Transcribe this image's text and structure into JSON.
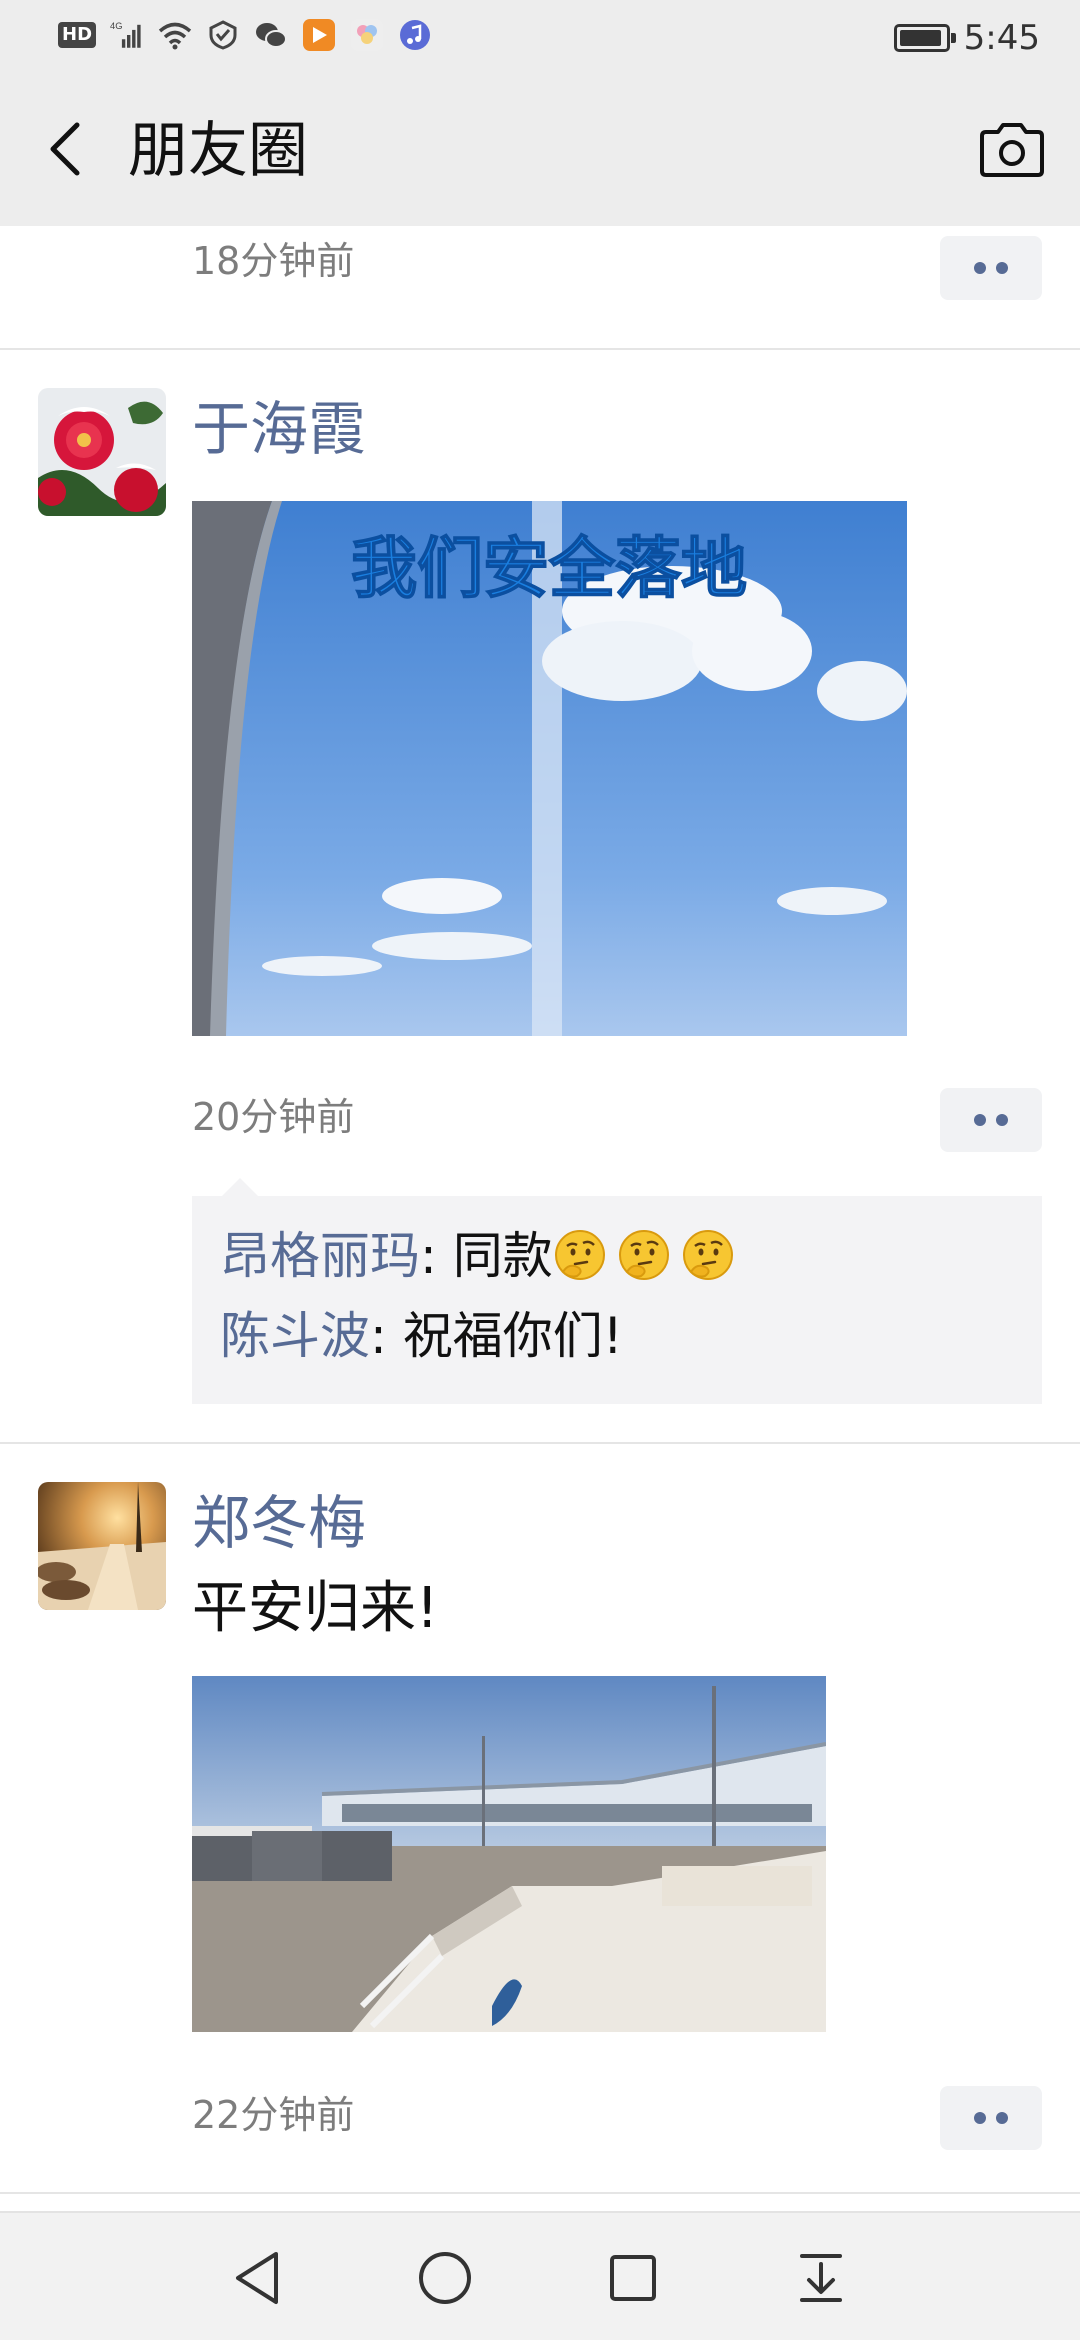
{
  "status_bar": {
    "hd_label": "HD",
    "network_label": "4G",
    "battery_level": 0.95,
    "time": "5:45",
    "icons": [
      "hd-icon",
      "signal-icon",
      "wifi-icon",
      "vpn-shield-icon",
      "wechat-icon",
      "video-app-icon",
      "photos-app-icon",
      "music-app-icon",
      "battery-icon"
    ]
  },
  "header": {
    "title": "朋友圈",
    "back_icon": "chevron-left-icon",
    "camera_icon": "camera-icon"
  },
  "feed": {
    "prev_post": {
      "time": "18分钟前"
    },
    "posts": [
      {
        "author": "于海霞",
        "avatar": "red-camellia-snow-photo",
        "image_caption": "我们安全落地",
        "time": "20分钟前",
        "comments": [
          {
            "name": "昂格丽玛",
            "separator": ": ",
            "text": "同款",
            "emoji": "thinking-face-emoji",
            "emoji_count": 3
          },
          {
            "name": "陈斗波",
            "separator": ": ",
            "text": "祝福你们!"
          }
        ]
      },
      {
        "author": "郑冬梅",
        "avatar": "snowy-night-street-photo",
        "text": "平安归来!",
        "time": "22分钟前"
      }
    ]
  },
  "nav_bar": {
    "icons": [
      "back-triangle-icon",
      "home-circle-icon",
      "recents-square-icon",
      "notification-pulldown-icon"
    ]
  },
  "colors": {
    "link_blue": "#576b95",
    "time_gray": "#7d7d7d",
    "header_bg": "#ededed"
  }
}
